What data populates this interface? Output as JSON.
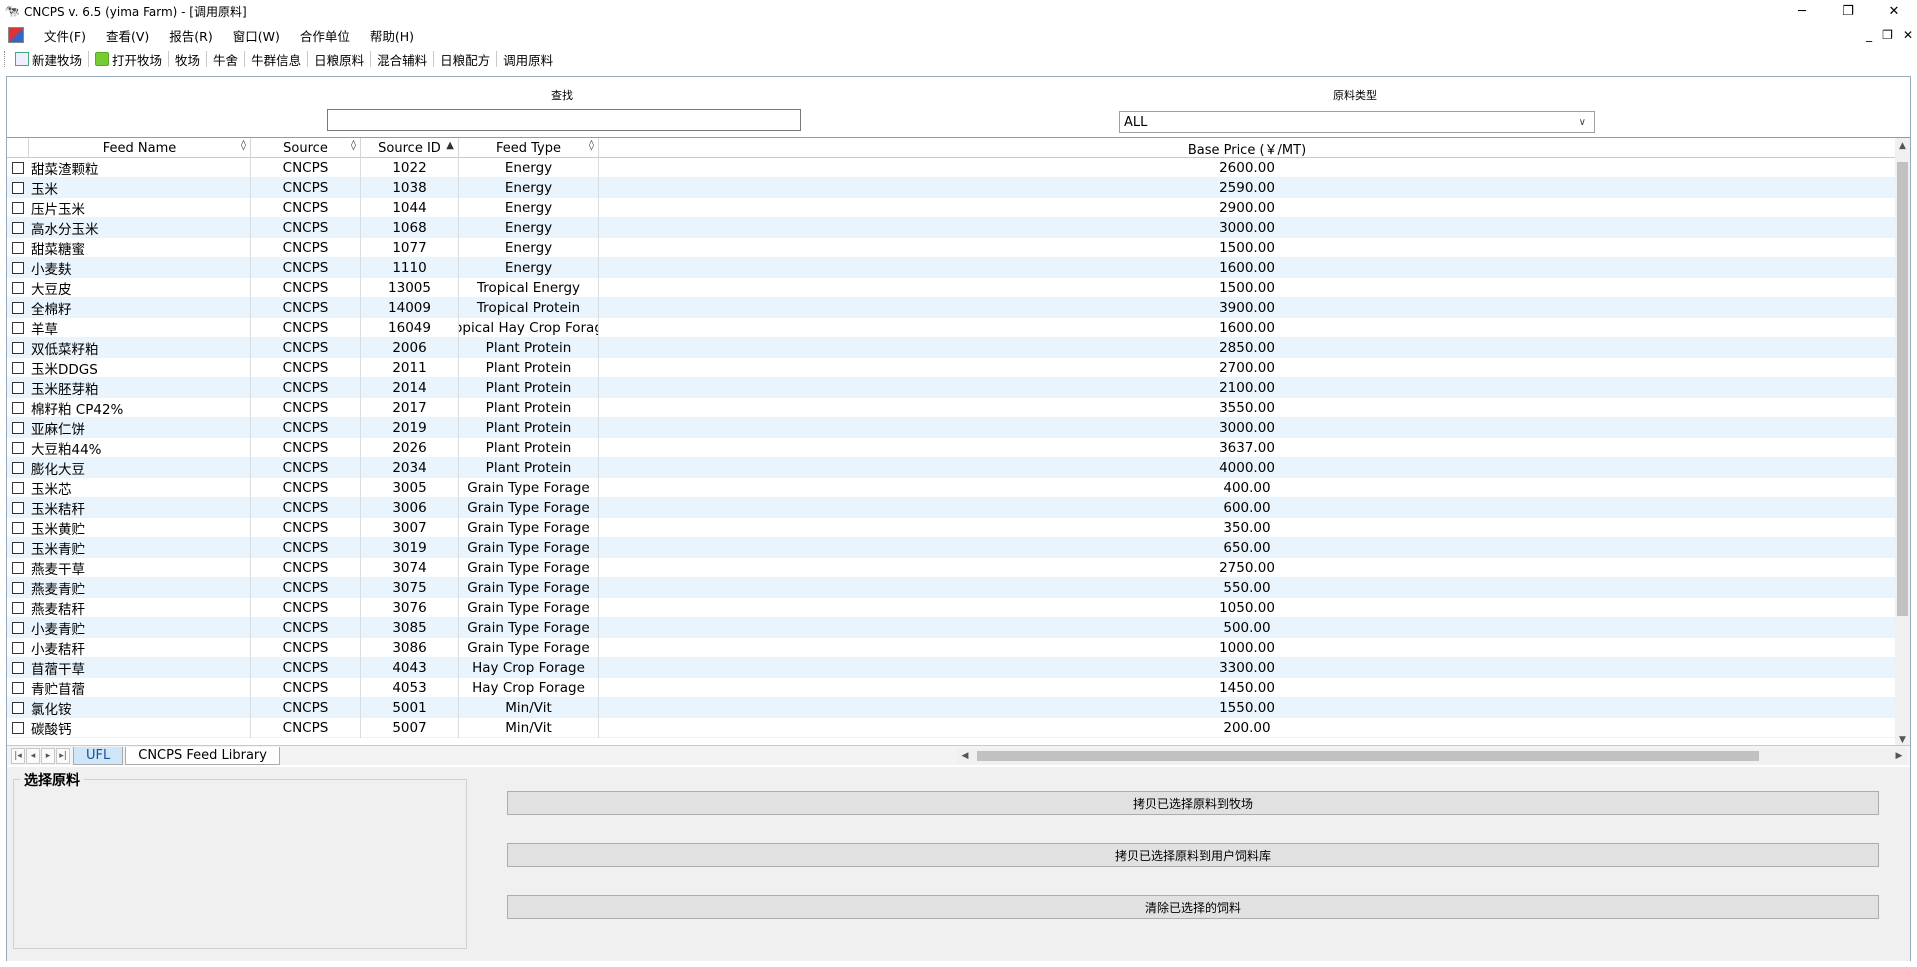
{
  "window": {
    "title": "CNCPS v. 6.5 (yima Farm) - [调用原料]",
    "controls": {
      "minimize": "─",
      "restore": "❐",
      "close": "✕"
    }
  },
  "menu": {
    "items": [
      "文件(F)",
      "查看(V)",
      "报告(R)",
      "窗口(W)",
      "合作单位",
      "帮助(H)"
    ],
    "mdi": {
      "minimize": "_",
      "restore": "❐",
      "close": "✕"
    }
  },
  "toolbar": {
    "items": [
      "新建牧场",
      "打开牧场",
      "牧场",
      "牛舍",
      "牛群信息",
      "日粮原料",
      "混合辅料",
      "日粮配方",
      "调用原料"
    ]
  },
  "filters": {
    "search_label": "查找",
    "search_value": "",
    "type_label": "原料类型",
    "type_value": "ALL"
  },
  "grid": {
    "columns": [
      "Feed Name",
      "Source",
      "Source ID",
      "Feed Type",
      "Base Price (￥/MT)"
    ],
    "rows": [
      {
        "name": "甜菜渣颗粒",
        "source": "CNCPS",
        "id": "1022",
        "type": "Energy",
        "price": "2600.00"
      },
      {
        "name": "玉米",
        "source": "CNCPS",
        "id": "1038",
        "type": "Energy",
        "price": "2590.00"
      },
      {
        "name": "压片玉米",
        "source": "CNCPS",
        "id": "1044",
        "type": "Energy",
        "price": "2900.00"
      },
      {
        "name": "高水分玉米",
        "source": "CNCPS",
        "id": "1068",
        "type": "Energy",
        "price": "3000.00"
      },
      {
        "name": "甜菜糖蜜",
        "source": "CNCPS",
        "id": "1077",
        "type": "Energy",
        "price": "1500.00"
      },
      {
        "name": "小麦麸",
        "source": "CNCPS",
        "id": "1110",
        "type": "Energy",
        "price": "1600.00"
      },
      {
        "name": "大豆皮",
        "source": "CNCPS",
        "id": "13005",
        "type": "Tropical Energy",
        "price": "1500.00"
      },
      {
        "name": "全棉籽",
        "source": "CNCPS",
        "id": "14009",
        "type": "Tropical Protein",
        "price": "3900.00"
      },
      {
        "name": "羊草",
        "source": "CNCPS",
        "id": "16049",
        "type": "opical Hay Crop Forag",
        "price": "1600.00"
      },
      {
        "name": "双低菜籽粕",
        "source": "CNCPS",
        "id": "2006",
        "type": "Plant Protein",
        "price": "2850.00"
      },
      {
        "name": "玉米DDGS",
        "source": "CNCPS",
        "id": "2011",
        "type": "Plant Protein",
        "price": "2700.00"
      },
      {
        "name": "玉米胚芽粕",
        "source": "CNCPS",
        "id": "2014",
        "type": "Plant Protein",
        "price": "2100.00"
      },
      {
        "name": "棉籽粕 CP42%",
        "source": "CNCPS",
        "id": "2017",
        "type": "Plant Protein",
        "price": "3550.00"
      },
      {
        "name": "亚麻仁饼",
        "source": "CNCPS",
        "id": "2019",
        "type": "Plant Protein",
        "price": "3000.00"
      },
      {
        "name": "大豆粕44%",
        "source": "CNCPS",
        "id": "2026",
        "type": "Plant Protein",
        "price": "3637.00"
      },
      {
        "name": "膨化大豆",
        "source": "CNCPS",
        "id": "2034",
        "type": "Plant Protein",
        "price": "4000.00"
      },
      {
        "name": "玉米芯",
        "source": "CNCPS",
        "id": "3005",
        "type": "Grain Type Forage",
        "price": "400.00"
      },
      {
        "name": "玉米秸秆",
        "source": "CNCPS",
        "id": "3006",
        "type": "Grain Type Forage",
        "price": "600.00"
      },
      {
        "name": "玉米黄贮",
        "source": "CNCPS",
        "id": "3007",
        "type": "Grain Type Forage",
        "price": "350.00"
      },
      {
        "name": "玉米青贮",
        "source": "CNCPS",
        "id": "3019",
        "type": "Grain Type Forage",
        "price": "650.00"
      },
      {
        "name": "燕麦干草",
        "source": "CNCPS",
        "id": "3074",
        "type": "Grain Type Forage",
        "price": "2750.00"
      },
      {
        "name": "燕麦青贮",
        "source": "CNCPS",
        "id": "3075",
        "type": "Grain Type Forage",
        "price": "550.00"
      },
      {
        "name": "燕麦秸秆",
        "source": "CNCPS",
        "id": "3076",
        "type": "Grain Type Forage",
        "price": "1050.00"
      },
      {
        "name": "小麦青贮",
        "source": "CNCPS",
        "id": "3085",
        "type": "Grain Type Forage",
        "price": "500.00"
      },
      {
        "name": "小麦秸秆",
        "source": "CNCPS",
        "id": "3086",
        "type": "Grain Type Forage",
        "price": "1000.00"
      },
      {
        "name": "苜蓿干草",
        "source": "CNCPS",
        "id": "4043",
        "type": "Hay Crop Forage",
        "price": "3300.00"
      },
      {
        "name": "青贮苜蓿",
        "source": "CNCPS",
        "id": "4053",
        "type": "Hay Crop Forage",
        "price": "1450.00"
      },
      {
        "name": "氯化铵",
        "source": "CNCPS",
        "id": "5001",
        "type": "Min/Vit",
        "price": "1550.00"
      },
      {
        "name": "碳酸钙",
        "source": "CNCPS",
        "id": "5007",
        "type": "Min/Vit",
        "price": "200.00"
      }
    ]
  },
  "tabs": [
    "UFL",
    "CNCPS Feed Library"
  ],
  "active_tab": "UFL",
  "selection": {
    "group_title": "选择原料",
    "buttons": [
      "拷贝已选择原料到牧场",
      "拷贝已选择原料到用户饲料库",
      "清除已选择的饲料"
    ]
  }
}
